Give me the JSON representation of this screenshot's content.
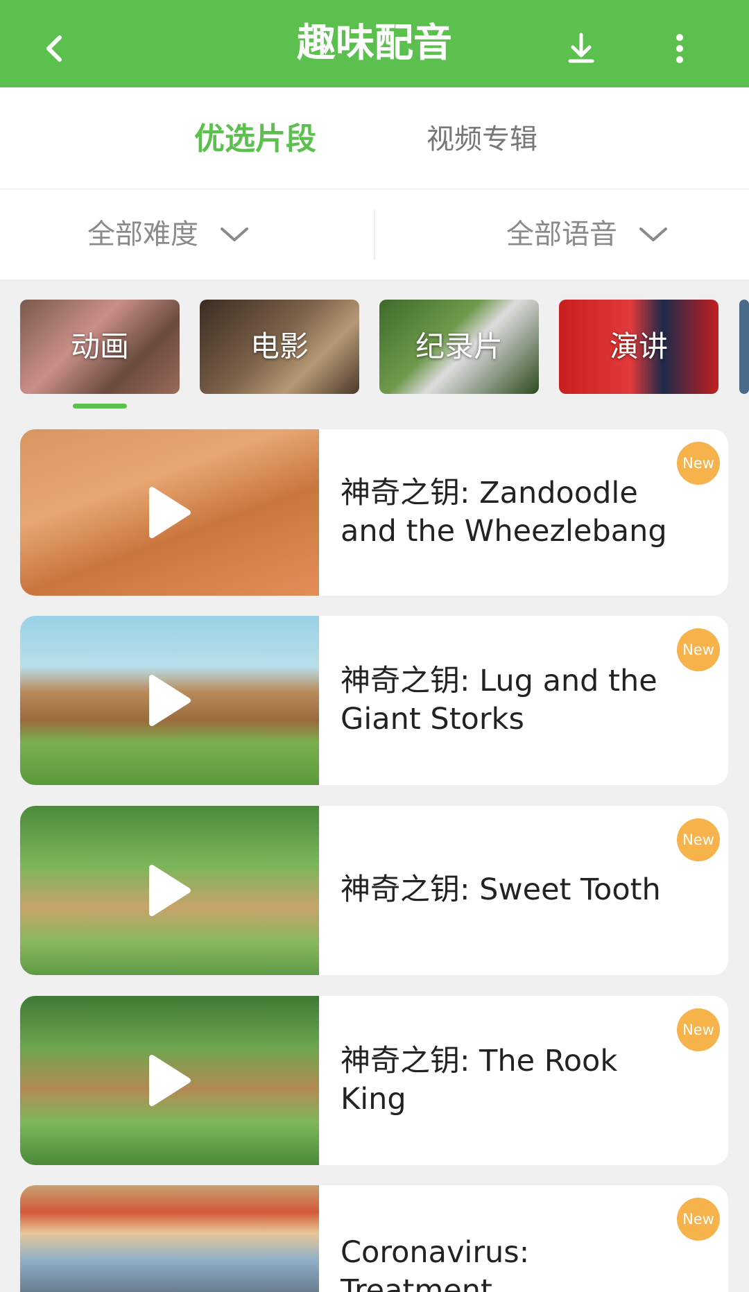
{
  "header": {
    "title": "趣味配音",
    "back_icon": "back-arrow-icon",
    "download_icon": "download-icon",
    "more_icon": "more-icon",
    "bar_color": "#5cc04e"
  },
  "tabs": [
    {
      "label": "优选片段",
      "active": true
    },
    {
      "label": "视频专辑",
      "active": false
    }
  ],
  "filters": {
    "difficulty": "全部难度",
    "language": "全部语音"
  },
  "categories": [
    {
      "label": "动画",
      "selected": true
    },
    {
      "label": "电影",
      "selected": false
    },
    {
      "label": "纪录片",
      "selected": false
    },
    {
      "label": "演讲",
      "selected": false
    }
  ],
  "items": [
    {
      "title": "神奇之钥: Zandoodle and the Wheezlebang",
      "badge": "New"
    },
    {
      "title": "神奇之钥: Lug and the Giant Storks",
      "badge": "New"
    },
    {
      "title": "神奇之钥: Sweet Tooth",
      "badge": "New"
    },
    {
      "title": "神奇之钥: The Rook King",
      "badge": "New"
    },
    {
      "title": "Coronavirus: Treatment",
      "badge": "New"
    }
  ],
  "colors": {
    "accent": "#5cc04e",
    "badge": "#f6b24b"
  }
}
